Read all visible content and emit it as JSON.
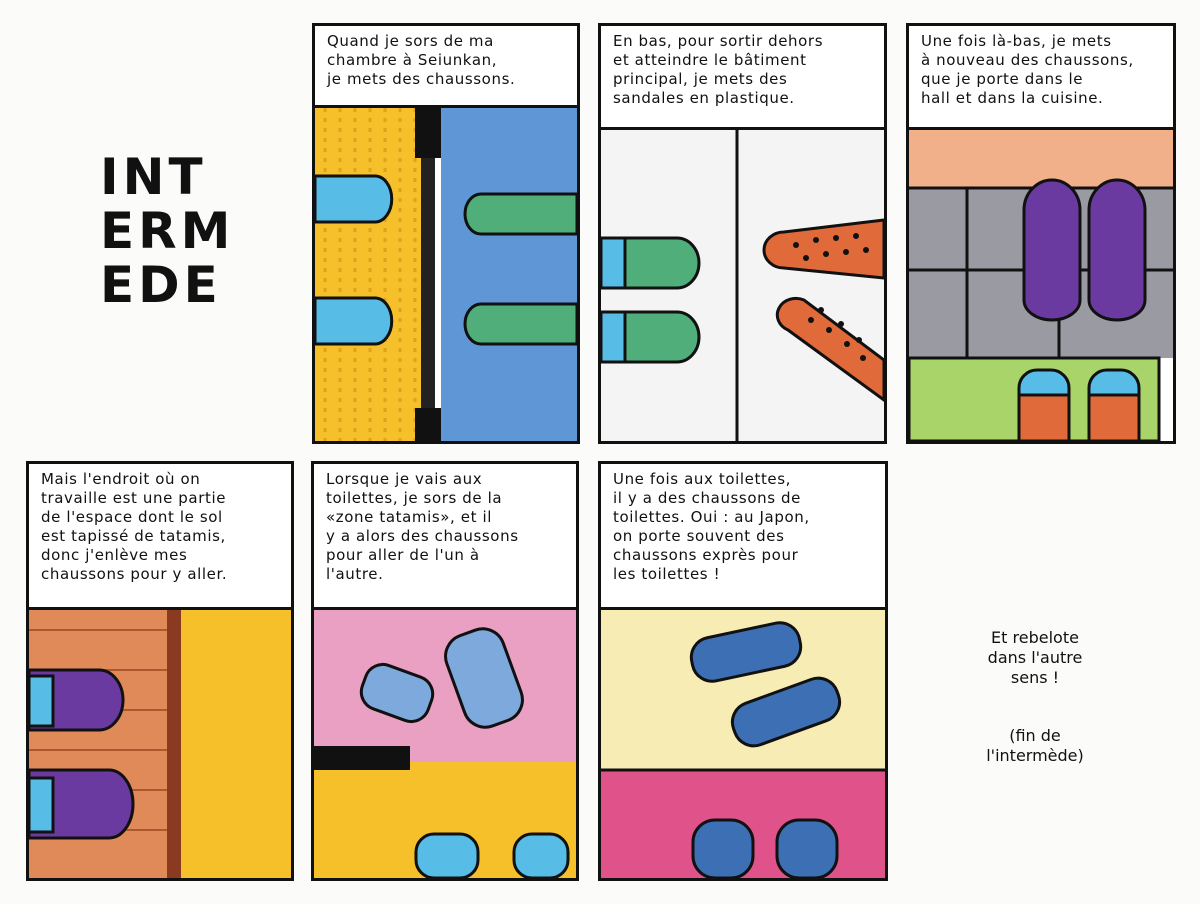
{
  "title": {
    "lines": [
      "INT",
      "ERM",
      "EDE"
    ]
  },
  "panels": [
    {
      "caption": "Quand je sors de ma\nchambre à Seiunkan,\nje mets des chaussons."
    },
    {
      "caption": "En bas, pour sortir dehors\net atteindre le bâtiment\nprincipal, je mets des\nsandales en plastique."
    },
    {
      "caption": "Une fois là-bas, je mets\nà nouveau des chaussons,\nque je porte dans le\nhall et dans la cuisine."
    },
    {
      "caption": "Mais l'endroit où on\ntravaille est une partie\nde l'espace dont le sol\nest tapissé de tatamis,\ndonc j'enlève mes\nchaussons pour y aller."
    },
    {
      "caption": "Lorsque je vais aux\ntoilettes, je sors de la\n«zone tatamis», et il\ny a alors des chaussons\npour aller de l'un à\nl'autre."
    },
    {
      "caption": "Une fois aux toilettes,\nil y a des chaussons de\ntoilettes. Oui : au Japon,\non porte souvent des\nchaussons exprès pour\nles toilettes !"
    }
  ],
  "outro": {
    "line1": "Et rebelote\ndans l'autre\nsens !",
    "line2": "(fin de\nl'intermède)"
  },
  "colors": {
    "ink": "#111111",
    "tatami_yellow": "#f5c02a",
    "floor_blue": "#5f97d6",
    "slipper_green": "#4fae7a",
    "slipper_purple": "#6b3aa0",
    "sock_blue": "#58bde6",
    "sandal_orange": "#e06a3a",
    "tile_gray": "#9a9aa3",
    "mat_green": "#a9d46a",
    "wood_orange": "#e08a5a",
    "pink": "#e9a0c3",
    "cream": "#f6ecb4",
    "magenta": "#e0528a",
    "toilet_blue": "#3d6fb5"
  }
}
